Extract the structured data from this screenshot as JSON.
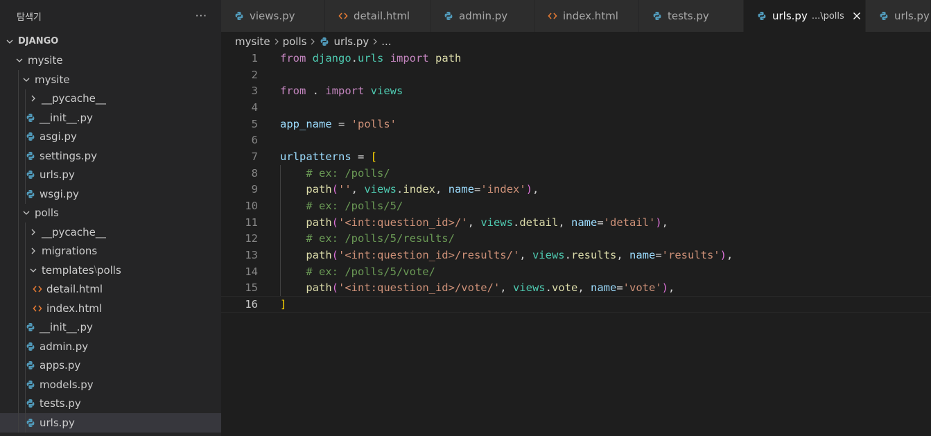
{
  "explorer": {
    "title": "탐색기",
    "more_label": "···",
    "root": "DJANGO",
    "items": [
      {
        "label": "mysite",
        "kind": "folder",
        "open": true,
        "depth": 1
      },
      {
        "label": "mysite",
        "kind": "folder",
        "open": true,
        "depth": 2
      },
      {
        "label": "__pycache__",
        "kind": "folder",
        "open": false,
        "depth": 3
      },
      {
        "label": "__init__.py",
        "kind": "python",
        "depth": 3
      },
      {
        "label": "asgi.py",
        "kind": "python",
        "depth": 3
      },
      {
        "label": "settings.py",
        "kind": "python",
        "depth": 3
      },
      {
        "label": "urls.py",
        "kind": "python",
        "depth": 3
      },
      {
        "label": "wsgi.py",
        "kind": "python",
        "depth": 3
      },
      {
        "label": "polls",
        "kind": "folder",
        "open": true,
        "depth": 2
      },
      {
        "label": "__pycache__",
        "kind": "folder",
        "open": false,
        "depth": 3
      },
      {
        "label": "migrations",
        "kind": "folder",
        "open": false,
        "depth": 3
      },
      {
        "label": "templates",
        "label2": "polls",
        "kind": "folder",
        "open": true,
        "depth": 3
      },
      {
        "label": "detail.html",
        "kind": "html",
        "depth": 4
      },
      {
        "label": "index.html",
        "kind": "html",
        "depth": 4
      },
      {
        "label": "__init__.py",
        "kind": "python",
        "depth": 3
      },
      {
        "label": "admin.py",
        "kind": "python",
        "depth": 3
      },
      {
        "label": "apps.py",
        "kind": "python",
        "depth": 3
      },
      {
        "label": "models.py",
        "kind": "python",
        "depth": 3
      },
      {
        "label": "tests.py",
        "kind": "python",
        "depth": 3
      },
      {
        "label": "urls.py",
        "kind": "python",
        "depth": 3,
        "selected": true
      }
    ]
  },
  "tabs": [
    {
      "label": "views.py",
      "kind": "python"
    },
    {
      "label": "detail.html",
      "kind": "html"
    },
    {
      "label": "admin.py",
      "kind": "python"
    },
    {
      "label": "index.html",
      "kind": "html"
    },
    {
      "label": "tests.py",
      "kind": "python"
    },
    {
      "label": "urls.py",
      "kind": "python",
      "active": true,
      "desc": "...\\polls"
    },
    {
      "label": "urls.py",
      "kind": "python"
    }
  ],
  "breadcrumb": {
    "parts": [
      "mysite",
      "polls"
    ],
    "file": "urls.py",
    "tail": "..."
  },
  "code": {
    "current_line": 16,
    "lines": [
      [
        [
          "k",
          "from"
        ],
        [
          "p",
          " "
        ],
        [
          "m",
          "django"
        ],
        [
          "p",
          "."
        ],
        [
          "m",
          "urls"
        ],
        [
          "p",
          " "
        ],
        [
          "k",
          "import"
        ],
        [
          "p",
          " "
        ],
        [
          "f",
          "path"
        ]
      ],
      [],
      [
        [
          "k",
          "from"
        ],
        [
          "p",
          " . "
        ],
        [
          "k",
          "import"
        ],
        [
          "p",
          " "
        ],
        [
          "m",
          "views"
        ]
      ],
      [],
      [
        [
          "v",
          "app_name"
        ],
        [
          "p",
          " = "
        ],
        [
          "s",
          "'polls'"
        ]
      ],
      [],
      [
        [
          "v",
          "urlpatterns"
        ],
        [
          "p",
          " = "
        ],
        [
          "b",
          "["
        ]
      ],
      [
        [
          "p",
          "    "
        ],
        [
          "c",
          "# ex: /polls/"
        ]
      ],
      [
        [
          "p",
          "    "
        ],
        [
          "f",
          "path"
        ],
        [
          "b2",
          "("
        ],
        [
          "s",
          "''"
        ],
        [
          "p",
          ", "
        ],
        [
          "m",
          "views"
        ],
        [
          "p",
          "."
        ],
        [
          "f",
          "index"
        ],
        [
          "p",
          ", "
        ],
        [
          "v",
          "name"
        ],
        [
          "p",
          "="
        ],
        [
          "s",
          "'index'"
        ],
        [
          "b2",
          ")"
        ],
        [
          "p",
          ","
        ]
      ],
      [
        [
          "p",
          "    "
        ],
        [
          "c",
          "# ex: /polls/5/"
        ]
      ],
      [
        [
          "p",
          "    "
        ],
        [
          "f",
          "path"
        ],
        [
          "b2",
          "("
        ],
        [
          "s",
          "'<int:question_id>/'"
        ],
        [
          "p",
          ", "
        ],
        [
          "m",
          "views"
        ],
        [
          "p",
          "."
        ],
        [
          "f",
          "detail"
        ],
        [
          "p",
          ", "
        ],
        [
          "v",
          "name"
        ],
        [
          "p",
          "="
        ],
        [
          "s",
          "'detail'"
        ],
        [
          "b2",
          ")"
        ],
        [
          "p",
          ","
        ]
      ],
      [
        [
          "p",
          "    "
        ],
        [
          "c",
          "# ex: /polls/5/results/"
        ]
      ],
      [
        [
          "p",
          "    "
        ],
        [
          "f",
          "path"
        ],
        [
          "b2",
          "("
        ],
        [
          "s",
          "'<int:question_id>/results/'"
        ],
        [
          "p",
          ", "
        ],
        [
          "m",
          "views"
        ],
        [
          "p",
          "."
        ],
        [
          "f",
          "results"
        ],
        [
          "p",
          ", "
        ],
        [
          "v",
          "name"
        ],
        [
          "p",
          "="
        ],
        [
          "s",
          "'results'"
        ],
        [
          "b2",
          ")"
        ],
        [
          "p",
          ","
        ]
      ],
      [
        [
          "p",
          "    "
        ],
        [
          "c",
          "# ex: /polls/5/vote/"
        ]
      ],
      [
        [
          "p",
          "    "
        ],
        [
          "f",
          "path"
        ],
        [
          "b2",
          "("
        ],
        [
          "s",
          "'<int:question_id>/vote/'"
        ],
        [
          "p",
          ", "
        ],
        [
          "m",
          "views"
        ],
        [
          "p",
          "."
        ],
        [
          "f",
          "vote"
        ],
        [
          "p",
          ", "
        ],
        [
          "v",
          "name"
        ],
        [
          "p",
          "="
        ],
        [
          "s",
          "'vote'"
        ],
        [
          "b2",
          ")"
        ],
        [
          "p",
          ","
        ]
      ],
      [
        [
          "b",
          "]"
        ]
      ]
    ]
  },
  "colors": {
    "python_icon": "#519aba",
    "html_icon": "#e37933",
    "sidebar": "#252526",
    "editor": "#1e1e1e"
  }
}
